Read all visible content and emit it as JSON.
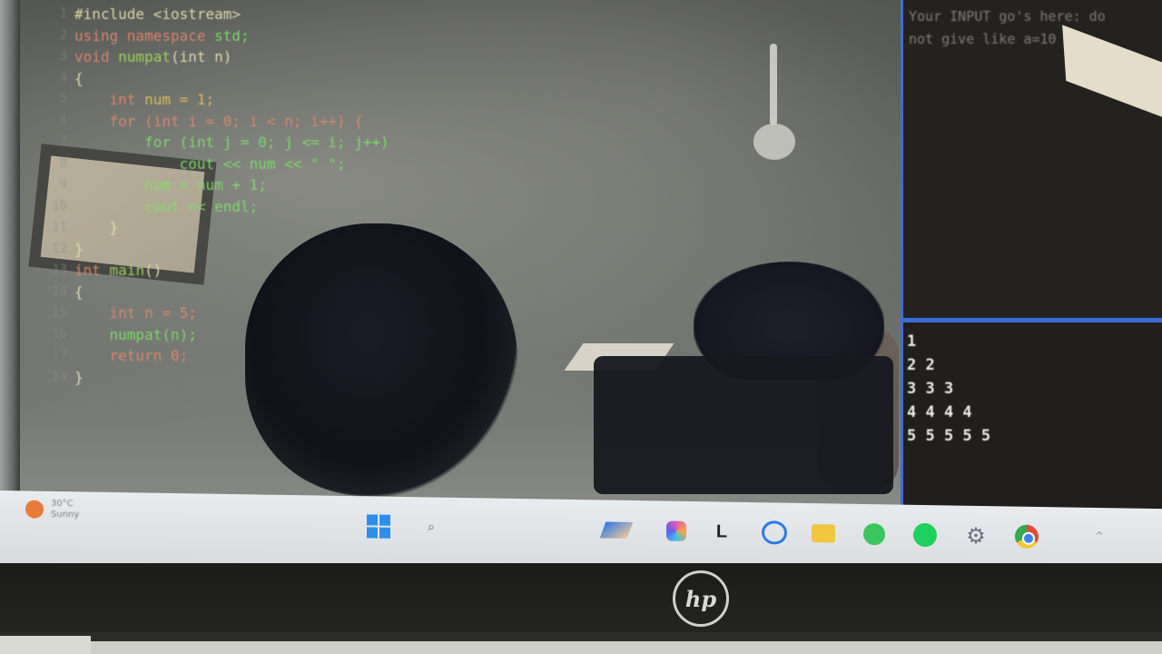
{
  "editor": {
    "gutter": "1\n2\n3\n4\n5\n6\n7\n8\n9\n10\n11\n12\n13\n14\n15\n16\n17\n18",
    "lines": {
      "l1": "#include <iostream>",
      "l2_kw": "using namespace",
      "l2_rest": " std;",
      "l3_type": "void",
      "l3_fn": " numpat",
      "l3_rest": "(int n)",
      "l4": "{",
      "l5_type": "    int",
      "l5_rest": " num = 1;",
      "l6": "    for (int i = 0; i < n; i++) {",
      "l7": "        for (int j = 0; j <= i; j++)",
      "l8": "            cout << num << \" \";",
      "l9": "        num = num + 1;",
      "l10": "        cout << endl;",
      "l11": "    }",
      "l12": "}",
      "l13_type": "int",
      "l13_fn": " main",
      "l13_rest": "()",
      "l14": "{",
      "l15": "    int n = 5;",
      "l16": "    numpat(n);",
      "l17": "    return 0;",
      "l18": "}"
    }
  },
  "input_panel": {
    "text": "Your INPUT go's here: do\nnot give like a=10"
  },
  "output_panel": {
    "text": "1\n2 2\n3 3 3\n4 4 4 4\n5 5 5 5 5"
  },
  "taskbar": {
    "weather_temp": "30°C",
    "weather_desc": "Sunny",
    "tray": "^"
  },
  "laptop": {
    "brand": "hp"
  }
}
